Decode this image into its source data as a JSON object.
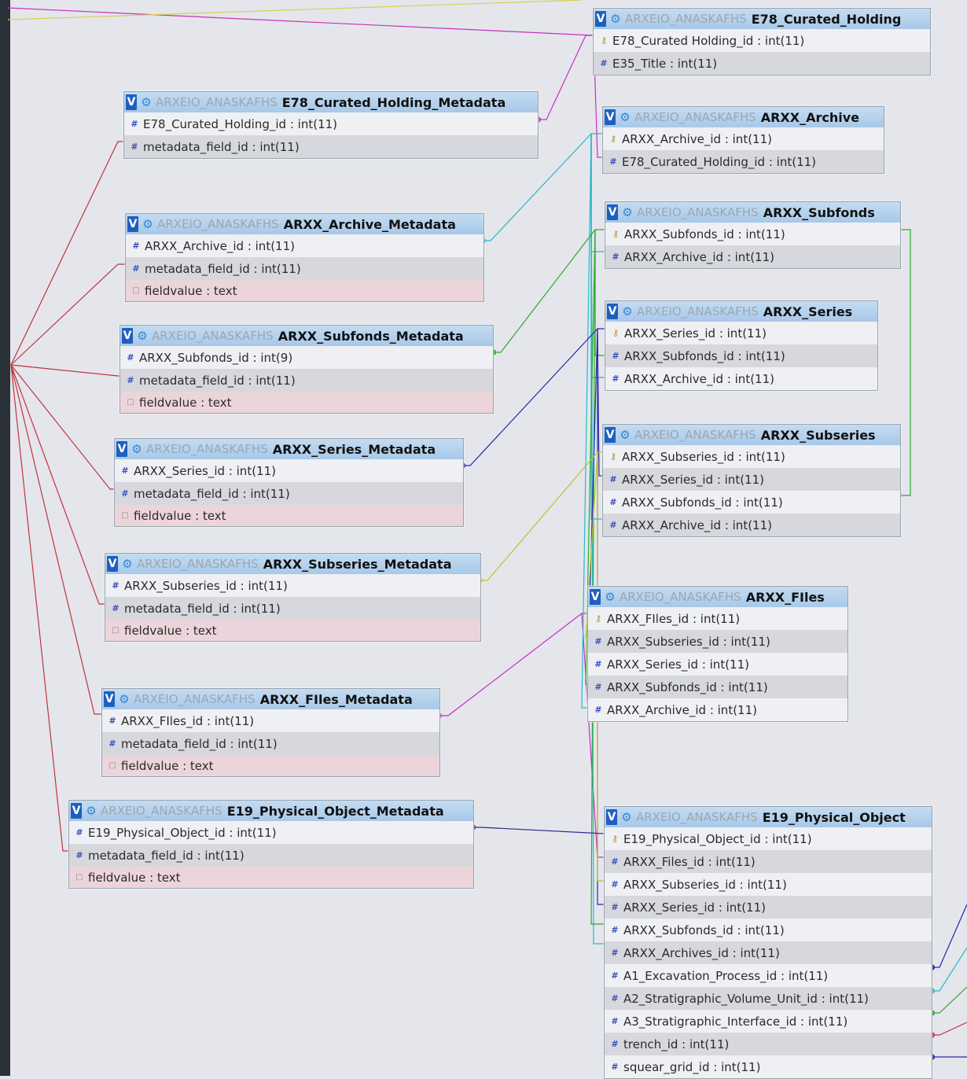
{
  "schema": "ARXEIO_ANASKAFHS",
  "toggle_label": "V",
  "tables": [
    {
      "name": "E78_Curated_Holding",
      "columns": [
        {
          "text": "E78_Curated Holding_id : int(11)",
          "type": "key"
        },
        {
          "text": "E35_Title : int(11)",
          "type": "int"
        }
      ]
    },
    {
      "name": "E78_Curated_Holding_Metadata",
      "columns": [
        {
          "text": "E78_Curated_Holding_id : int(11)",
          "type": "int"
        },
        {
          "text": "metadata_field_id : int(11)",
          "type": "int"
        }
      ]
    },
    {
      "name": "ARXX_Archive",
      "columns": [
        {
          "text": "ARXX_Archive_id : int(11)",
          "type": "key"
        },
        {
          "text": "E78_Curated_Holding_id : int(11)",
          "type": "int"
        }
      ]
    },
    {
      "name": "ARXX_Archive_Metadata",
      "columns": [
        {
          "text": "ARXX_Archive_id : int(11)",
          "type": "int"
        },
        {
          "text": "metadata_field_id : int(11)",
          "type": "int"
        },
        {
          "text": "fieldvalue : text",
          "type": "text"
        }
      ]
    },
    {
      "name": "ARXX_Subfonds",
      "columns": [
        {
          "text": "ARXX_Subfonds_id : int(11)",
          "type": "key"
        },
        {
          "text": "ARXX_Archive_id : int(11)",
          "type": "int"
        }
      ]
    },
    {
      "name": "ARXX_Subfonds_Metadata",
      "columns": [
        {
          "text": "ARXX_Subfonds_id : int(9)",
          "type": "int"
        },
        {
          "text": "metadata_field_id : int(11)",
          "type": "int"
        },
        {
          "text": "fieldvalue : text",
          "type": "text"
        }
      ]
    },
    {
      "name": "ARXX_Series",
      "columns": [
        {
          "text": "ARXX_Series_id : int(11)",
          "type": "key"
        },
        {
          "text": "ARXX_Subfonds_id : int(11)",
          "type": "int"
        },
        {
          "text": "ARXX_Archive_id : int(11)",
          "type": "int"
        }
      ]
    },
    {
      "name": "ARXX_Series_Metadata",
      "columns": [
        {
          "text": "ARXX_Series_id : int(11)",
          "type": "int"
        },
        {
          "text": "metadata_field_id : int(11)",
          "type": "int"
        },
        {
          "text": "fieldvalue : text",
          "type": "text"
        }
      ]
    },
    {
      "name": "ARXX_Subseries",
      "columns": [
        {
          "text": "ARXX_Subseries_id : int(11)",
          "type": "key"
        },
        {
          "text": "ARXX_Series_id : int(11)",
          "type": "int"
        },
        {
          "text": "ARXX_Subfonds_id : int(11)",
          "type": "int"
        },
        {
          "text": "ARXX_Archive_id : int(11)",
          "type": "int"
        }
      ]
    },
    {
      "name": "ARXX_Subseries_Metadata",
      "columns": [
        {
          "text": "ARXX_Subseries_id : int(11)",
          "type": "int"
        },
        {
          "text": "metadata_field_id : int(11)",
          "type": "int"
        },
        {
          "text": "fieldvalue : text",
          "type": "text"
        }
      ]
    },
    {
      "name": "ARXX_FIles",
      "columns": [
        {
          "text": "ARXX_FIles_id : int(11)",
          "type": "key"
        },
        {
          "text": "ARXX_Subseries_id : int(11)",
          "type": "int"
        },
        {
          "text": "ARXX_Series_id : int(11)",
          "type": "int"
        },
        {
          "text": "ARXX_Subfonds_id : int(11)",
          "type": "int"
        },
        {
          "text": "ARXX_Archive_id : int(11)",
          "type": "int"
        }
      ]
    },
    {
      "name": "ARXX_FIles_Metadata",
      "columns": [
        {
          "text": "ARXX_FIles_id : int(11)",
          "type": "int"
        },
        {
          "text": "metadata_field_id : int(11)",
          "type": "int"
        },
        {
          "text": "fieldvalue : text",
          "type": "text"
        }
      ]
    },
    {
      "name": "E19_Physical_Object_Metadata",
      "columns": [
        {
          "text": "E19_Physical_Object_id : int(11)",
          "type": "int"
        },
        {
          "text": "metadata_field_id : int(11)",
          "type": "int"
        },
        {
          "text": "fieldvalue : text",
          "type": "text"
        }
      ]
    },
    {
      "name": "E19_Physical_Object",
      "columns": [
        {
          "text": "E19_Physical_Object_id : int(11)",
          "type": "key"
        },
        {
          "text": "ARXX_Files_id : int(11)",
          "type": "int"
        },
        {
          "text": "ARXX_Subseries_id : int(11)",
          "type": "int"
        },
        {
          "text": "ARXX_Series_id : int(11)",
          "type": "int"
        },
        {
          "text": "ARXX_Subfonds_id : int(11)",
          "type": "int"
        },
        {
          "text": "ARXX_Archives_id : int(11)",
          "type": "int"
        },
        {
          "text": "A1_Excavation_Process_id : int(11)",
          "type": "int"
        },
        {
          "text": "A2_Stratigraphic_Volume_Unit_id : int(11)",
          "type": "int"
        },
        {
          "text": "A3_Stratigraphic_Interface_id : int(11)",
          "type": "int"
        },
        {
          "text": "trench_id : int(11)",
          "type": "int"
        },
        {
          "text": "squear_grid_id : int(11)",
          "type": "int"
        }
      ]
    }
  ],
  "relation_colors": {
    "metadata": "#c0343e",
    "curated_holding": "#c830c0",
    "archive": "#28b8c8",
    "subfonds": "#2caa2c",
    "series": "#2828a8",
    "subseries": "#c0c028",
    "physical_object": "#2a2a90"
  },
  "icons": {
    "key": "key-icon",
    "int": "hash-icon",
    "text": "text-icon",
    "gear": "gear-icon"
  }
}
